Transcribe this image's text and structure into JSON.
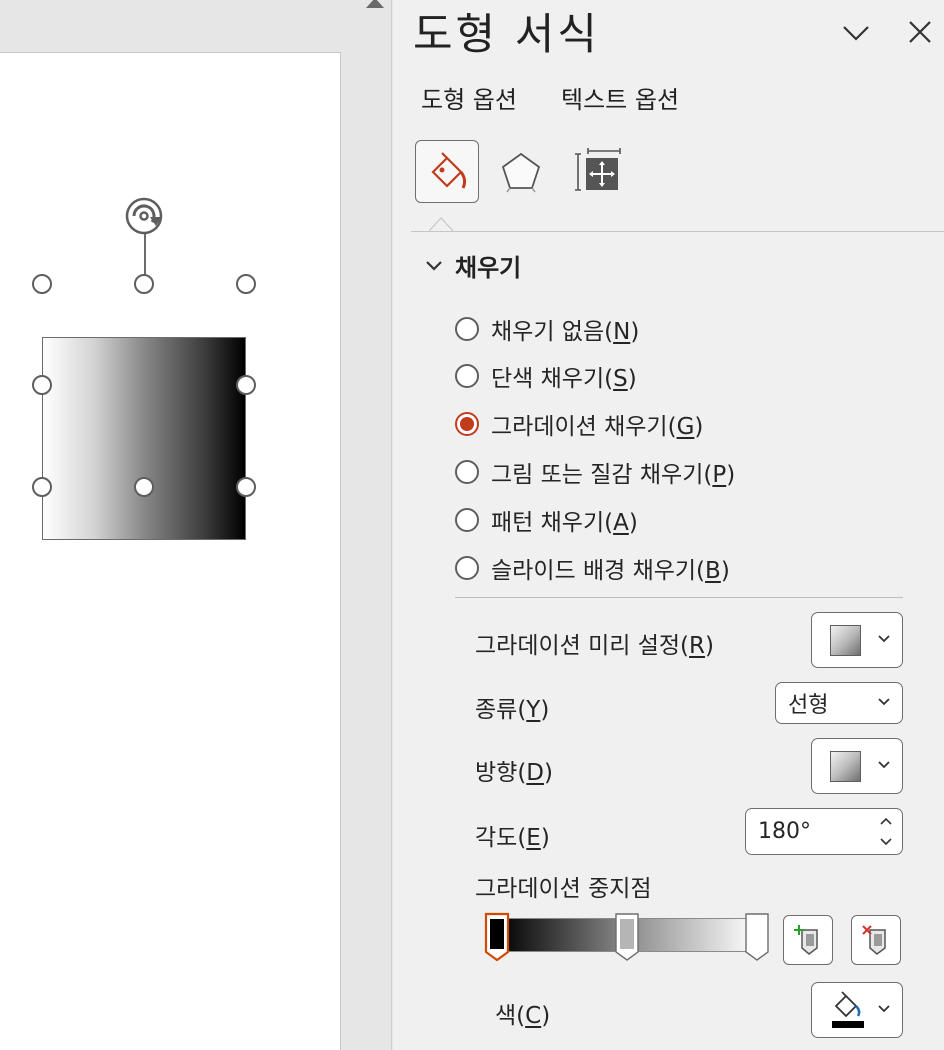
{
  "pane": {
    "title": "도형 서식",
    "tabs": [
      "도형 옵션",
      "텍스트 옵션"
    ],
    "icons": {
      "fill_line": "paint-bucket-icon",
      "effects": "pentagon-icon",
      "size_properties": "size-properties-icon",
      "options": "chevron-down-icon",
      "close": "close-icon"
    }
  },
  "fill_section": {
    "title": "채우기",
    "options": [
      {
        "label": "채우기 없음(",
        "key": "N",
        "end": ")",
        "selected": false
      },
      {
        "label": "단색 채우기(",
        "key": "S",
        "end": ")",
        "selected": false
      },
      {
        "label": "그라데이션 채우기(",
        "key": "G",
        "end": ")",
        "selected": true
      },
      {
        "label": "그림 또는 질감 채우기(",
        "key": "P",
        "end": ")",
        "selected": false
      },
      {
        "label": "패턴 채우기(",
        "key": "A",
        "end": ")",
        "selected": false
      },
      {
        "label": "슬라이드 배경 채우기(",
        "key": "B",
        "end": ")",
        "selected": false
      }
    ]
  },
  "gradient": {
    "preset_label": {
      "text": "그라데이션 미리 설정(",
      "key": "R",
      "end": ")"
    },
    "type_label": {
      "text": "종류(",
      "key": "Y",
      "end": ")"
    },
    "type_value": "선형",
    "direction_label": {
      "text": "방향(",
      "key": "D",
      "end": ")"
    },
    "angle_label": {
      "text": "각도(",
      "key": "E",
      "end": ")"
    },
    "angle_value": "180°",
    "stops_label": "그라데이션 중지점",
    "stop_positions_pct": [
      0,
      50,
      100
    ],
    "selected_stop": 0,
    "color_label": {
      "text": "색(",
      "key": "C",
      "end": ")"
    }
  },
  "colors": {
    "accent": "#c13c1c",
    "pane_bg": "#f0f0f0",
    "selected_stop_outline": "#d04a02"
  }
}
